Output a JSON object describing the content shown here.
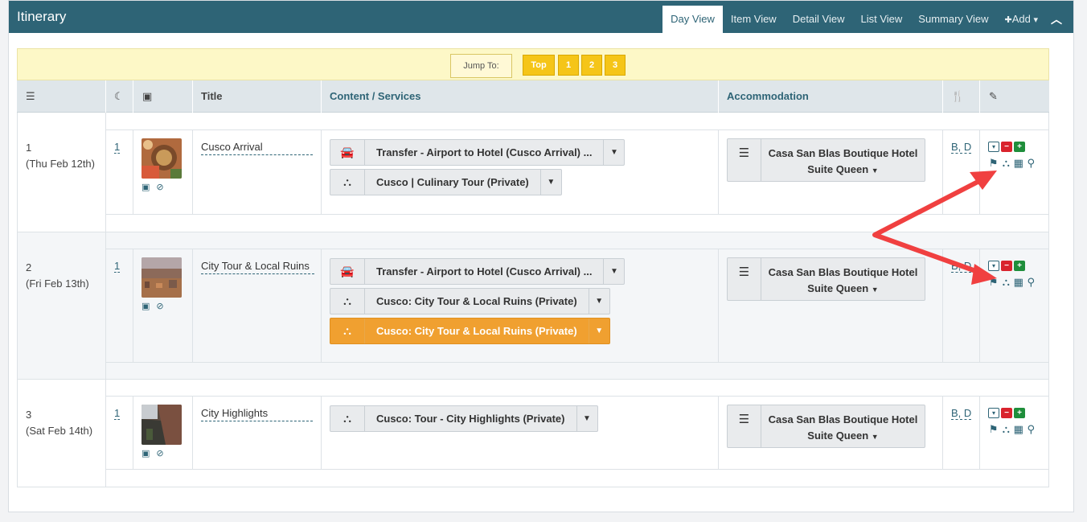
{
  "header": {
    "title": "Itinerary",
    "tabs": [
      {
        "label": "Day View",
        "active": true
      },
      {
        "label": "Item View"
      },
      {
        "label": "Detail View"
      },
      {
        "label": "List View"
      },
      {
        "label": "Summary View"
      }
    ],
    "add_label": "Add"
  },
  "jump": {
    "label": "Jump To:",
    "buttons": [
      "Top",
      "1",
      "2",
      "3"
    ]
  },
  "columns": {
    "title": "Title",
    "content": "Content / Services",
    "accommodation": "Accommodation"
  },
  "days": [
    {
      "day": "1",
      "date": "(Thu Feb 12th)",
      "nights": "1",
      "title": "Cusco Arrival",
      "services": [
        {
          "icon": "car-icon",
          "label": "Transfer - Airport to Hotel (Cusco Arrival) ..."
        },
        {
          "icon": "binoculars-icon",
          "label": "Cusco | Culinary Tour (Private)"
        }
      ],
      "hotel_name": "Casa San Blas Boutique Hotel",
      "room": "Suite Queen",
      "meals": "B, D"
    },
    {
      "day": "2",
      "date": "(Fri Feb 13th)",
      "nights": "1",
      "title": "City Tour & Local Ruins",
      "services": [
        {
          "icon": "car-icon",
          "label": "Transfer - Airport to Hotel (Cusco Arrival) ..."
        },
        {
          "icon": "binoculars-icon",
          "label": "Cusco: City Tour & Local Ruins (Private)"
        },
        {
          "icon": "binoculars-icon",
          "label": "Cusco: City Tour & Local Ruins (Private)",
          "highlight": true
        }
      ],
      "hotel_name": "Casa San Blas Boutique Hotel",
      "room": "Suite Queen",
      "meals": "B, D"
    },
    {
      "day": "3",
      "date": "(Sat Feb 14th)",
      "nights": "1",
      "title": "City Highlights",
      "services": [
        {
          "icon": "binoculars-icon",
          "label": "Cusco: Tour - City Highlights (Private)"
        }
      ],
      "hotel_name": "Casa San Blas Boutique Hotel",
      "room": "Suite Queen",
      "meals": "B, D"
    }
  ],
  "colors": {
    "header": "#2e6476",
    "highlight": "#f0a030",
    "jump_bar": "#fdf8c7",
    "jump_button": "#f5c518",
    "annotation_arrow": "#f04040"
  }
}
